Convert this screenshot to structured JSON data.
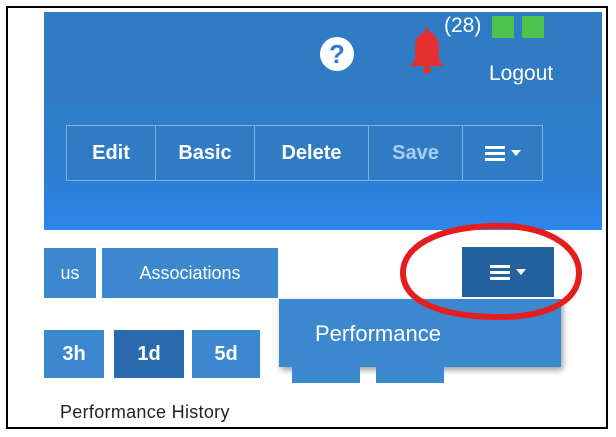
{
  "header": {
    "help_symbol": "?",
    "notification_count": "(28)",
    "logout_label": "Logout",
    "status_indicator_color": "#4cc24c",
    "icons": [
      "help-icon",
      "bell-icon"
    ]
  },
  "toolbar": {
    "edit_label": "Edit",
    "basic_label": "Basic",
    "delete_label": "Delete",
    "save_label": "Save",
    "menu_icon": "hamburger-menu-icon"
  },
  "tabs": {
    "status_label": "us",
    "associations_label": "Associations"
  },
  "more_menu": {
    "icon": "hamburger-menu-icon",
    "dropdown_items": [
      "Performance"
    ]
  },
  "time_ranges": [
    "3h",
    "1d",
    "5d"
  ],
  "selected_range": "1d",
  "section_labels": "Performance  History",
  "colors": {
    "primary_blue": "#2f7cc4",
    "selected_blue": "#2560a0",
    "highlight_circle": "#e41e1e"
  }
}
